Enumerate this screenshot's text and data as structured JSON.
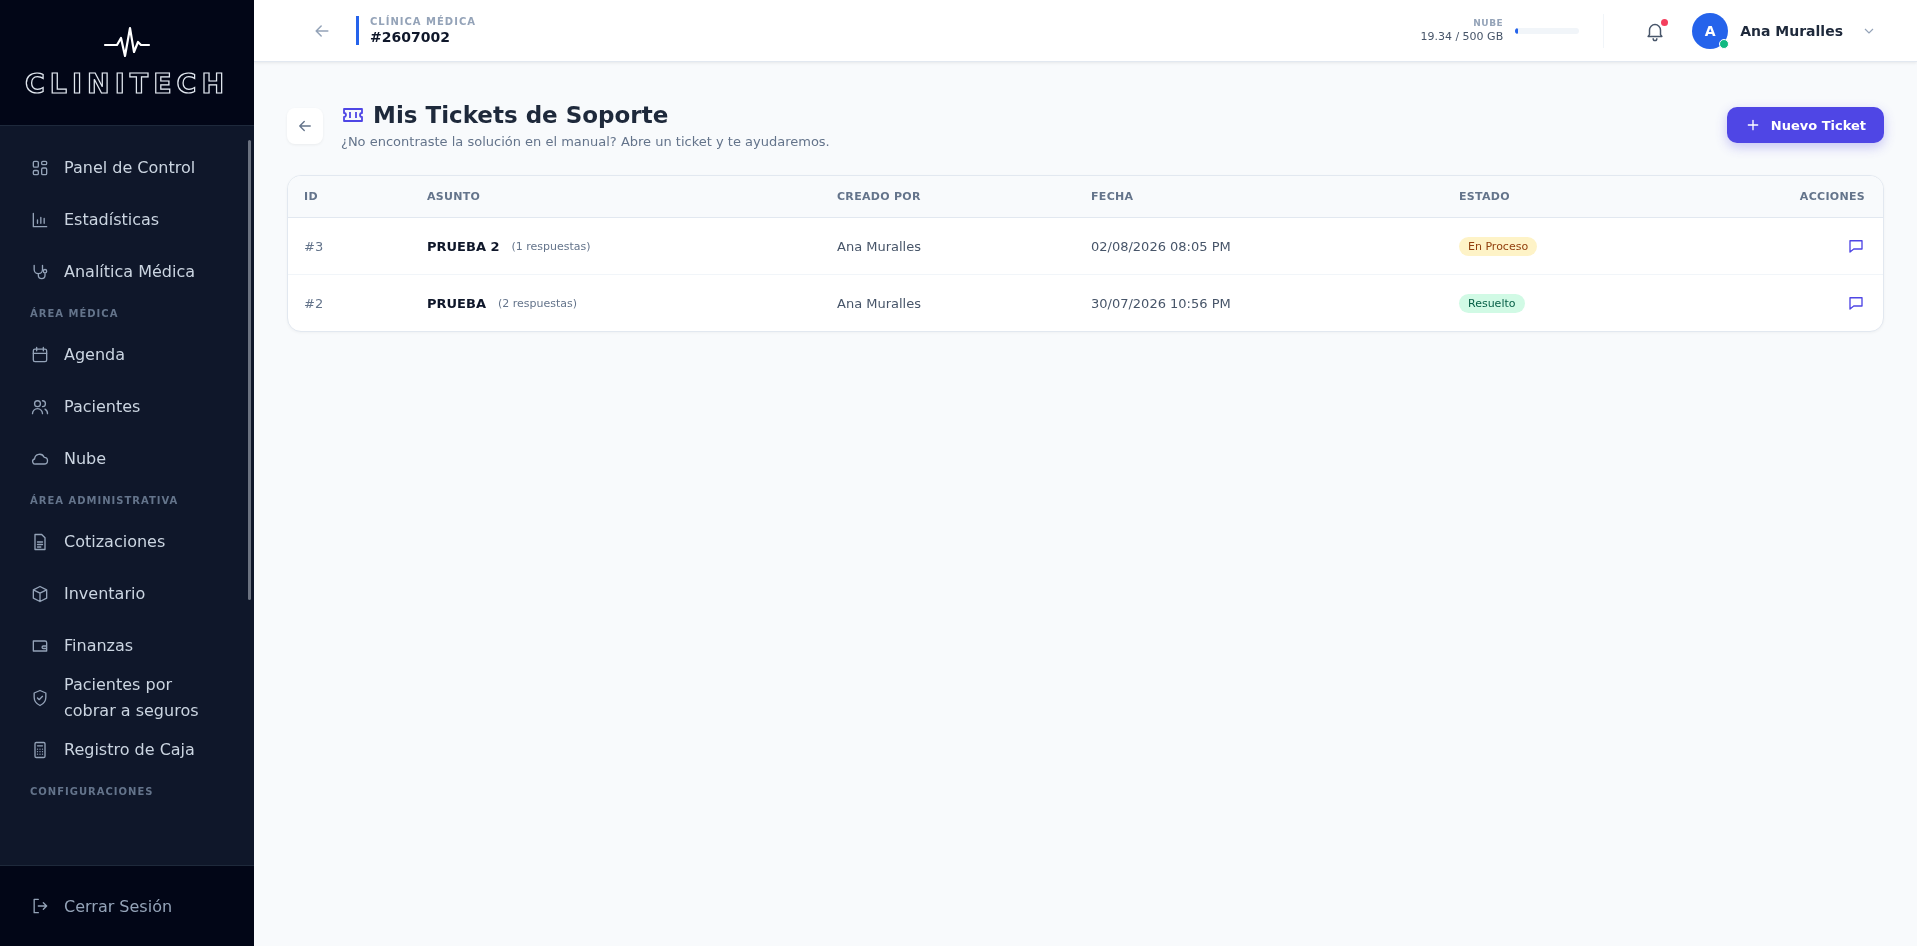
{
  "sidebar": {
    "logo": "CLINITECH",
    "sections": [
      {
        "items": [
          {
            "label": "Panel de Control",
            "selected": false
          },
          {
            "label": "Estadísticas",
            "selected": false
          },
          {
            "label": "Analítica Médica",
            "selected": false
          }
        ]
      },
      {
        "heading": "ÁREA MÉDICA",
        "items": [
          {
            "label": "Agenda",
            "selected": false
          },
          {
            "label": "Pacientes",
            "selected": false
          },
          {
            "label": "Nube",
            "selected": false
          }
        ]
      },
      {
        "heading": "ÁREA ADMINISTRATIVA",
        "items": [
          {
            "label": "Cotizaciones",
            "selected": false
          },
          {
            "label": "Inventario",
            "selected": false
          },
          {
            "label": "Finanzas",
            "selected": false
          },
          {
            "label": "Pacientes por cobrar a seguros",
            "selected": false
          },
          {
            "label": "Registro de Caja",
            "selected": false
          }
        ]
      },
      {
        "heading": "CONFIGURACIONES"
      }
    ],
    "logout": "Cerrar Sesión"
  },
  "header": {
    "clinic_label": "CLÍNICA MÉDICA",
    "clinic_id": "#2607002",
    "storage": {
      "label": "NUBE",
      "reading": "19.34 / 500 GB",
      "level": 0.04
    },
    "notifications_unread": true,
    "user": {
      "initial": "A",
      "name": "Ana Muralles",
      "online": true
    }
  },
  "page": {
    "title": "Mis Tickets de Soporte",
    "subtitle": "¿No encontraste la solución en el manual? Abre un ticket y te ayudaremos.",
    "new_button": "Nuevo Ticket"
  },
  "table": {
    "columns": [
      "ID",
      "ASUNTO",
      "CREADO POR",
      "FECHA",
      "ESTADO",
      "ACCIONES"
    ],
    "rows": [
      {
        "id": "#3",
        "subject": "PRUEBA 2",
        "replies": "(1 respuestas)",
        "author": "Ana Muralles",
        "date": "02/08/2026 08:05 PM",
        "status": "En Proceso",
        "kind": "pending"
      },
      {
        "id": "#2",
        "subject": "PRUEBA",
        "replies": "(2 respuestas)",
        "author": "Ana Muralles",
        "date": "30/07/2026 10:56 PM",
        "status": "Resuelto",
        "kind": "done"
      }
    ]
  }
}
